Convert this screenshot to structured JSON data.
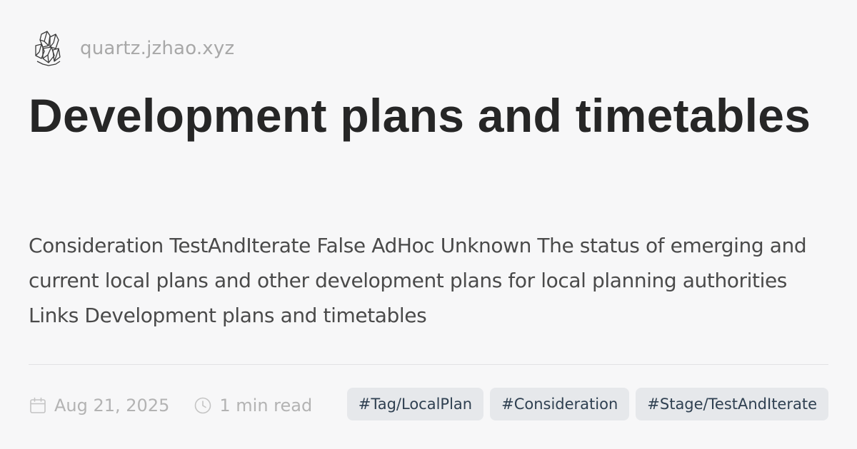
{
  "site": {
    "name": "quartz.jzhao.xyz",
    "logo_icon": "crystal-logo-icon"
  },
  "page": {
    "title": "Development plans and timetables",
    "description": "Consideration TestAndIterate False AdHoc Unknown The status of emerging and current local plans and other development plans for local planning authorities Links Development plans and timetables"
  },
  "meta": {
    "date": "Aug 21, 2025",
    "date_icon": "calendar-icon",
    "read_time": "1 min read",
    "read_time_icon": "clock-icon"
  },
  "tags": [
    {
      "label": "#Tag/LocalPlan"
    },
    {
      "label": "#Consideration"
    },
    {
      "label": "#Stage/TestAndIterate"
    }
  ],
  "colors": {
    "background": "#f7f7f8",
    "title": "#262626",
    "body_text": "#4a4a4a",
    "muted": "#a8a8a8",
    "tag_bg": "#e6e8eb",
    "tag_text": "#2f4051"
  }
}
